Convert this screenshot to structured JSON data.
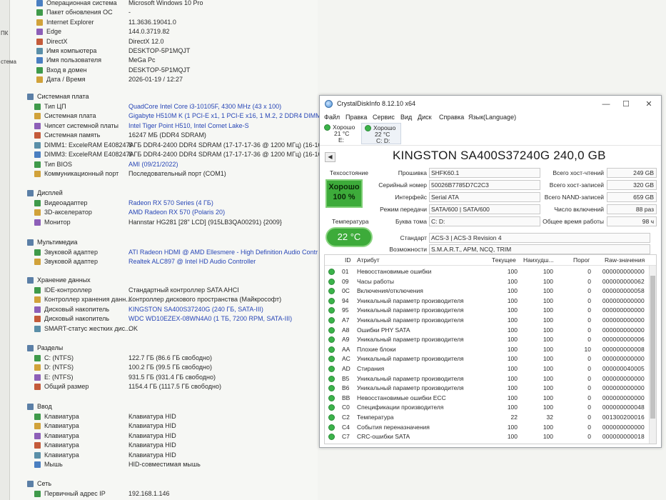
{
  "left_edge": [
    "ПК",
    "стема"
  ],
  "system": [
    {
      "label": "Операционная система",
      "value": "Microsoft Windows 10 Pro"
    },
    {
      "label": "Пакет обновления ОС",
      "value": "-"
    },
    {
      "label": "Internet Explorer",
      "value": "11.3636.19041.0"
    },
    {
      "label": "Edge",
      "value": "144.0.3719.82"
    },
    {
      "label": "DirectX",
      "value": "DirectX 12.0"
    },
    {
      "label": "Имя компьютера",
      "value": "DESKTOP-5P1MQJT"
    },
    {
      "label": "Имя пользователя",
      "value": "MeGa Pc"
    },
    {
      "label": "Вход в домен",
      "value": "DESKTOP-5P1MQJT"
    },
    {
      "label": "Дата / Время",
      "value": "2026-01-19 / 12:27"
    }
  ],
  "motherboard": {
    "title": "Системная плата",
    "items": [
      {
        "label": "Тип ЦП",
        "value": "QuadCore Intel Core i3-10105F, 4300 MHz (43 x 100)",
        "link": true
      },
      {
        "label": "Системная плата",
        "value": "Gigabyte H510M K  (1 PCI-E x1, 1 PCI-E x16, 1 M.2, 2 DDR4 DIMM,",
        "link": true
      },
      {
        "label": "Чипсет системной платы",
        "value": "Intel Tiger Point H510, Intel Comet Lake-S",
        "link": true
      },
      {
        "label": "Системная память",
        "value": "16247 МБ  (DDR4 SDRAM)",
        "link": false
      },
      {
        "label": "DIMM1: ExceleRAM E408247A",
        "value": "8 ГБ DDR4-2400 DDR4 SDRAM  (17-17-17-36 @ 1200 МГц)  (16-16-",
        "link": false
      },
      {
        "label": "DIMM3: ExceleRAM E408247A",
        "value": "8 ГБ DDR4-2400 DDR4 SDRAM  (17-17-17-36 @ 1200 МГц)  (16-16-",
        "link": false
      },
      {
        "label": "Тип BIOS",
        "value": "AMI (09/21/2022)",
        "link": true
      },
      {
        "label": "Коммуникационный порт",
        "value": "Последовательный порт (COM1)",
        "link": false
      }
    ]
  },
  "display": {
    "title": "Дисплей",
    "items": [
      {
        "label": "Видеоадаптер",
        "value": "Radeon RX 570 Series  (4 ГБ)",
        "link": true
      },
      {
        "label": "3D-акселератор",
        "value": "AMD Radeon RX 570 (Polaris 20)",
        "link": true
      },
      {
        "label": "Монитор",
        "value": "Hannstar HG281  [28\" LCD]  (915LB3QA00291)  {2009}",
        "link": false
      }
    ]
  },
  "multimedia": {
    "title": "Мультимедиа",
    "items": [
      {
        "label": "Звуковой адаптер",
        "value": "ATI Radeon HDMI @ AMD Ellesmere - High Definition Audio Contr",
        "link": true
      },
      {
        "label": "Звуковой адаптер",
        "value": "Realtek ALC897 @ Intel HD Audio Controller",
        "link": true
      }
    ]
  },
  "storage": {
    "title": "Хранение данных",
    "items": [
      {
        "label": "IDE-контроллер",
        "value": "Стандартный контроллер SATA AHCI",
        "link": false
      },
      {
        "label": "Контроллер хранения данн...",
        "value": "Контроллер дискового пространства (Майкрософт)",
        "link": false
      },
      {
        "label": "Дисковый накопитель",
        "value": "KINGSTON SA400S37240G  (240 ГБ, SATA-III)",
        "link": true
      },
      {
        "label": "Дисковый накопитель",
        "value": "WDC WD10EZEX-08WN4A0  (1 ТБ, 7200 RPM, SATA-III)",
        "link": true
      },
      {
        "label": "SMART-статус жестких дис...",
        "value": "OK",
        "link": false
      }
    ]
  },
  "partitions": {
    "title": "Разделы",
    "items": [
      {
        "label": "C: (NTFS)",
        "value": "122.7 ГБ (86.6 ГБ свободно)"
      },
      {
        "label": "D: (NTFS)",
        "value": "100.2 ГБ (99.5 ГБ свободно)"
      },
      {
        "label": "E: (NTFS)",
        "value": "931.5 ГБ (931.4 ГБ свободно)"
      },
      {
        "label": "Общий размер",
        "value": "1154.4 ГБ (1117.5 ГБ свободно)"
      }
    ]
  },
  "input": {
    "title": "Ввод",
    "items": [
      {
        "label": "Клавиатура",
        "value": "Клавиатура HID"
      },
      {
        "label": "Клавиатура",
        "value": "Клавиатура HID"
      },
      {
        "label": "Клавиатура",
        "value": "Клавиатура HID"
      },
      {
        "label": "Клавиатура",
        "value": "Клавиатура HID"
      },
      {
        "label": "Клавиатура",
        "value": "Клавиатура HID"
      },
      {
        "label": "Мышь",
        "value": "HID-совместимая мышь"
      }
    ]
  },
  "network": {
    "title": "Сеть",
    "items": [
      {
        "label": "Первичный адрес IP",
        "value": "192.168.1.146"
      }
    ]
  },
  "cdi": {
    "title": "CrystalDiskInfo 8.12.10 x64",
    "minimize": "—",
    "maximize": "☐",
    "close": "✕",
    "menu": [
      "Файл",
      "Правка",
      "Сервис",
      "Вид",
      "Диск",
      "Справка",
      "Язык(Language)"
    ],
    "tabs": [
      {
        "status": "Хорошо",
        "temp": "21 °C",
        "drive": "E:"
      },
      {
        "status": "Хорошо",
        "temp": "22 °C",
        "drive": "C: D:"
      }
    ],
    "prev": "◀",
    "model": "KINGSTON SA400S37240G 240,0 GB",
    "health_label": "Техсостояние",
    "health_status": "Хорошо",
    "health_percent": "100 %",
    "temp_label": "Температура",
    "temp_value": "22 °C",
    "fields_left": [
      {
        "label": "Прошивка",
        "value": "SHFK60.1"
      },
      {
        "label": "Серийный номер",
        "value": "50026B7785D7C2C3"
      },
      {
        "label": "Интерфейс",
        "value": "Serial ATA"
      },
      {
        "label": "Режим передачи",
        "value": "SATA/600 | SATA/600"
      },
      {
        "label": "Буква тома",
        "value": "C: D:"
      }
    ],
    "fields_right": [
      {
        "label": "Всего хост-чтений",
        "value": "249 GB"
      },
      {
        "label": "Всего хост-записей",
        "value": "320 GB"
      },
      {
        "label": "Всего NAND-записей",
        "value": "659 GB"
      },
      {
        "label": "Число включений",
        "value": "88 раз"
      },
      {
        "label": "Общее время работы",
        "value": "98 ч"
      }
    ],
    "standard_label": "Стандарт",
    "standard_value": "ACS-3 | ACS-3 Revision 4",
    "features_label": "Возможности",
    "features_value": "S.M.A.R.T., APM, NCQ, TRIM",
    "smart_headers": {
      "id": "ID",
      "attr": "Атрибут",
      "cur": "Текущее",
      "wor": "Наихудш...",
      "thr": "Порог",
      "raw": "Raw-значения"
    },
    "smart_rows": [
      {
        "id": "01",
        "attr": "Невосстановимые ошибки",
        "cur": "100",
        "wor": "100",
        "thr": "0",
        "raw": "000000000000"
      },
      {
        "id": "09",
        "attr": "Часы работы",
        "cur": "100",
        "wor": "100",
        "thr": "0",
        "raw": "000000000062"
      },
      {
        "id": "0C",
        "attr": "Включения/отключения",
        "cur": "100",
        "wor": "100",
        "thr": "0",
        "raw": "000000000058"
      },
      {
        "id": "94",
        "attr": "Уникальный параметр производителя",
        "cur": "100",
        "wor": "100",
        "thr": "0",
        "raw": "000000000000"
      },
      {
        "id": "95",
        "attr": "Уникальный параметр производителя",
        "cur": "100",
        "wor": "100",
        "thr": "0",
        "raw": "000000000000"
      },
      {
        "id": "A7",
        "attr": "Уникальный параметр производителя",
        "cur": "100",
        "wor": "100",
        "thr": "0",
        "raw": "000000000000"
      },
      {
        "id": "A8",
        "attr": "Ошибки PHY SATA",
        "cur": "100",
        "wor": "100",
        "thr": "0",
        "raw": "000000000000"
      },
      {
        "id": "A9",
        "attr": "Уникальный параметр производителя",
        "cur": "100",
        "wor": "100",
        "thr": "0",
        "raw": "000000000006"
      },
      {
        "id": "AA",
        "attr": "Плохие блоки",
        "cur": "100",
        "wor": "100",
        "thr": "10",
        "raw": "000000000008"
      },
      {
        "id": "AC",
        "attr": "Уникальный параметр производителя",
        "cur": "100",
        "wor": "100",
        "thr": "0",
        "raw": "000000000000"
      },
      {
        "id": "AD",
        "attr": "Стирания",
        "cur": "100",
        "wor": "100",
        "thr": "0",
        "raw": "000000040005"
      },
      {
        "id": "B5",
        "attr": "Уникальный параметр производителя",
        "cur": "100",
        "wor": "100",
        "thr": "0",
        "raw": "000000000000"
      },
      {
        "id": "B6",
        "attr": "Уникальный параметр производителя",
        "cur": "100",
        "wor": "100",
        "thr": "0",
        "raw": "000000000000"
      },
      {
        "id": "BB",
        "attr": "Невосстановимые ошибки ECC",
        "cur": "100",
        "wor": "100",
        "thr": "0",
        "raw": "000000000000"
      },
      {
        "id": "C0",
        "attr": "Спецификации производителя",
        "cur": "100",
        "wor": "100",
        "thr": "0",
        "raw": "000000000048"
      },
      {
        "id": "C2",
        "attr": "Температура",
        "cur": "22",
        "wor": "32",
        "thr": "0",
        "raw": "001300200016"
      },
      {
        "id": "C4",
        "attr": "События переназначения",
        "cur": "100",
        "wor": "100",
        "thr": "0",
        "raw": "000000000000"
      },
      {
        "id": "C7",
        "attr": "CRC-ошибки SATA",
        "cur": "100",
        "wor": "100",
        "thr": "0",
        "raw": "000000000018"
      }
    ]
  }
}
